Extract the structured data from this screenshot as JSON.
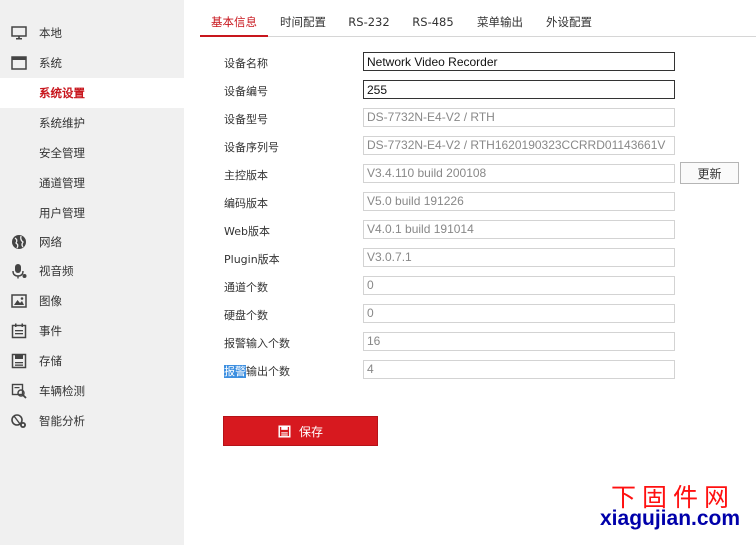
{
  "sidebar": {
    "items": [
      {
        "label": "本地",
        "icon": "monitor-icon"
      },
      {
        "label": "系统",
        "icon": "system-window-icon"
      },
      {
        "label": "系统设置",
        "active": true
      },
      {
        "label": "系统维护"
      },
      {
        "label": "安全管理"
      },
      {
        "label": "通道管理"
      },
      {
        "label": "用户管理"
      },
      {
        "label": "网络",
        "icon": "globe-icon"
      },
      {
        "label": "视音频",
        "icon": "microphone-icon"
      },
      {
        "label": "图像",
        "icon": "image-icon"
      },
      {
        "label": "事件",
        "icon": "calendar-icon"
      },
      {
        "label": "存储",
        "icon": "save-disk-icon"
      },
      {
        "label": "车辆检测",
        "icon": "vehicle-search-icon"
      },
      {
        "label": "智能分析",
        "icon": "smart-analysis-icon"
      }
    ]
  },
  "tabs": [
    {
      "label": "基本信息",
      "active": true
    },
    {
      "label": "时间配置"
    },
    {
      "label": "RS-232"
    },
    {
      "label": "RS-485"
    },
    {
      "label": "菜单输出"
    },
    {
      "label": "外设配置"
    }
  ],
  "form": {
    "device_name": {
      "label": "设备名称",
      "value": "Network Video Recorder"
    },
    "device_no": {
      "label": "设备编号",
      "value": "255"
    },
    "model": {
      "label": "设备型号",
      "value": "DS-7732N-E4-V2 / RTH"
    },
    "serial": {
      "label": "设备序列号",
      "value": "DS-7732N-E4-V2 / RTH1620190323CCRRD01143661V"
    },
    "firmware": {
      "label": "主控版本",
      "value": "V3.4.110 build 200108"
    },
    "encoder": {
      "label": "编码版本",
      "value": "V5.0 build 191226"
    },
    "web": {
      "label": "Web版本",
      "value": "V4.0.1 build 191014"
    },
    "plugin": {
      "label": "Plugin版本",
      "value": "V3.0.7.1"
    },
    "channels": {
      "label": "通道个数",
      "value": "0"
    },
    "hdd": {
      "label": "硬盘个数",
      "value": "0"
    },
    "alarm_in": {
      "label": "报警输入个数",
      "value": "16"
    },
    "alarm_out": {
      "label_hl": "报警",
      "label_rest": "输出个数",
      "value": "4"
    }
  },
  "buttons": {
    "update_label": "更新",
    "save_label": "保存"
  },
  "watermark": {
    "cn": "下固件网",
    "en": "xiagujian.com"
  },
  "colors": {
    "accent": "#c8161d",
    "save_bg": "#d7191f",
    "sidebar_bg": "#f0f0f0",
    "highlight": "#3d8fe0"
  }
}
